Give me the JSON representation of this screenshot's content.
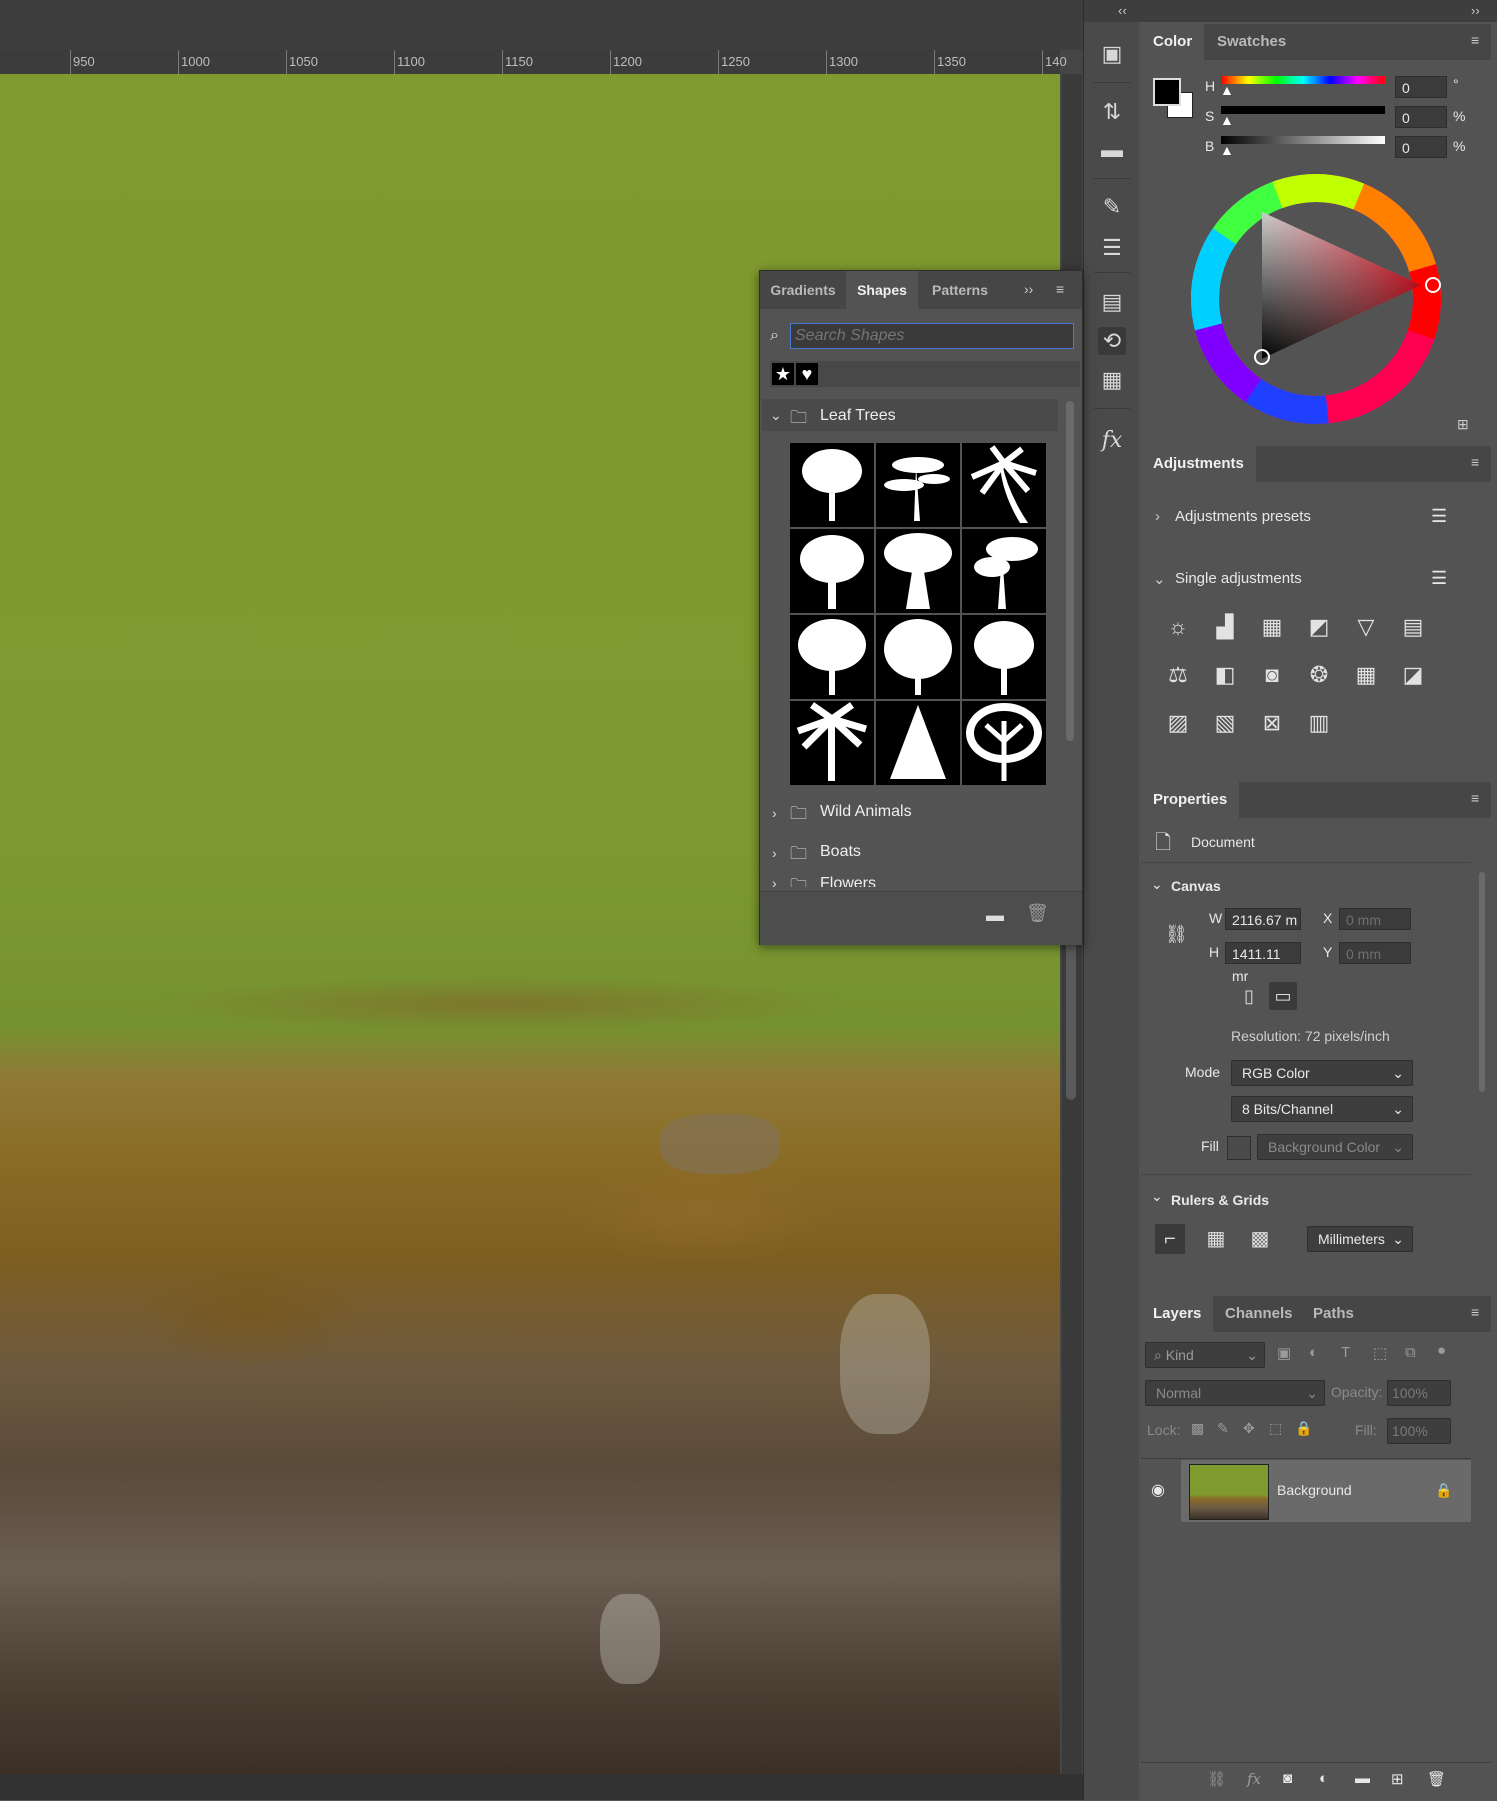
{
  "ruler": {
    "ticks": [
      "950",
      "1000",
      "1050",
      "1100",
      "1150",
      "1200",
      "1250",
      "1300",
      "1350",
      "140"
    ]
  },
  "shapes_panel": {
    "tabs": [
      "Gradients",
      "Shapes",
      "Patterns"
    ],
    "active_tab": "Shapes",
    "search_placeholder": "Search Shapes",
    "groups": [
      {
        "name": "Leaf Trees",
        "expanded": true
      },
      {
        "name": "Wild Animals",
        "expanded": false
      },
      {
        "name": "Boats",
        "expanded": false
      },
      {
        "name": "Flowers",
        "expanded": false
      }
    ]
  },
  "color_panel": {
    "tabs": [
      "Color",
      "Swatches"
    ],
    "active_tab": "Color",
    "h_label": "H",
    "s_label": "S",
    "b_label": "B",
    "h_value": "0",
    "s_value": "0",
    "b_value": "0",
    "h_unit": "°",
    "s_unit": "%",
    "b_unit": "%",
    "foreground": "#000000",
    "background": "#ffffff"
  },
  "adjustments_panel": {
    "title": "Adjustments",
    "presets_label": "Adjustments presets",
    "single_label": "Single adjustments"
  },
  "properties_panel": {
    "title": "Properties",
    "doc_label": "Document",
    "canvas_label": "Canvas",
    "w_label": "W",
    "h_label": "H",
    "x_label": "X",
    "y_label": "Y",
    "w_value": "2116.67 m",
    "h_value": "1411.11 mr",
    "x_value": "0 mm",
    "y_value": "0 mm",
    "resolution": "Resolution: 72 pixels/inch",
    "mode_label": "Mode",
    "mode_value": "RGB Color",
    "depth_value": "8 Bits/Channel",
    "fill_label": "Fill",
    "fill_value": "Background Color",
    "rulers_label": "Rulers & Grids",
    "units_value": "Millimeters"
  },
  "layers_panel": {
    "tabs": [
      "Layers",
      "Channels",
      "Paths"
    ],
    "active_tab": "Layers",
    "kind_label": "Kind",
    "blend_mode": "Normal",
    "opacity_label": "Opacity:",
    "opacity_value": "100%",
    "lock_label": "Lock:",
    "fill_label": "Fill:",
    "fill_value": "100%",
    "layer_name": "Background"
  }
}
